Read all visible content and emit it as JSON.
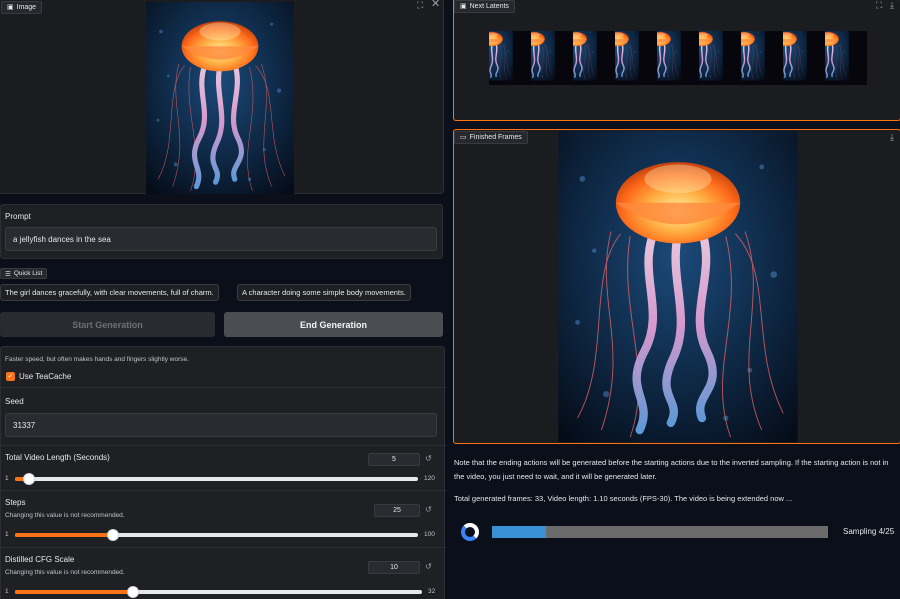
{
  "image_panel": {
    "label": "Image"
  },
  "prompt": {
    "title": "Prompt",
    "value": "a jellyfish dances in the sea"
  },
  "quick_list": {
    "label": "Quick List",
    "items": [
      "The girl dances gracefully, with clear movements, full of charm.",
      "A character doing some simple body movements."
    ]
  },
  "buttons": {
    "start": "Start Generation",
    "end": "End Generation"
  },
  "teacache": {
    "note": "Faster speed, but often makes hands and fingers slightly worse.",
    "label": "Use TeaCache",
    "checked": true
  },
  "seed": {
    "title": "Seed",
    "value": "31337"
  },
  "video_length": {
    "title": "Total Video Length (Seconds)",
    "value": "5",
    "min": "1",
    "max": "120",
    "fraction": 0.034
  },
  "steps": {
    "title": "Steps",
    "note": "Changing this value is not recommended.",
    "value": "25",
    "min": "1",
    "max": "100",
    "fraction": 0.242
  },
  "cfg": {
    "title": "Distilled CFG Scale",
    "note": "Changing this value is not recommended.",
    "value": "10",
    "min": "1",
    "max": "32",
    "fraction": 0.29
  },
  "latents_panel": {
    "label": "Next Latents"
  },
  "frames_panel": {
    "label": "Finished Frames"
  },
  "info": {
    "note": "Note that the ending actions will be generated before the starting actions due to the inverted sampling. If the starting action is not in the video, you just need to wait, and it will be generated later.",
    "status": "Total generated frames: 33, Video length: 1.10 seconds (FPS-30). The video is being extended now ...",
    "sampling": "Sampling 4/25",
    "progress": 0.16
  },
  "colors": {
    "accent": "#f97316",
    "progress": "#3b8fd4",
    "background": "#0b0f19"
  },
  "icons": [
    "fullscreen-icon",
    "close-icon",
    "download-icon",
    "video-icon",
    "image-icon",
    "reset-icon",
    "spinner-icon"
  ]
}
